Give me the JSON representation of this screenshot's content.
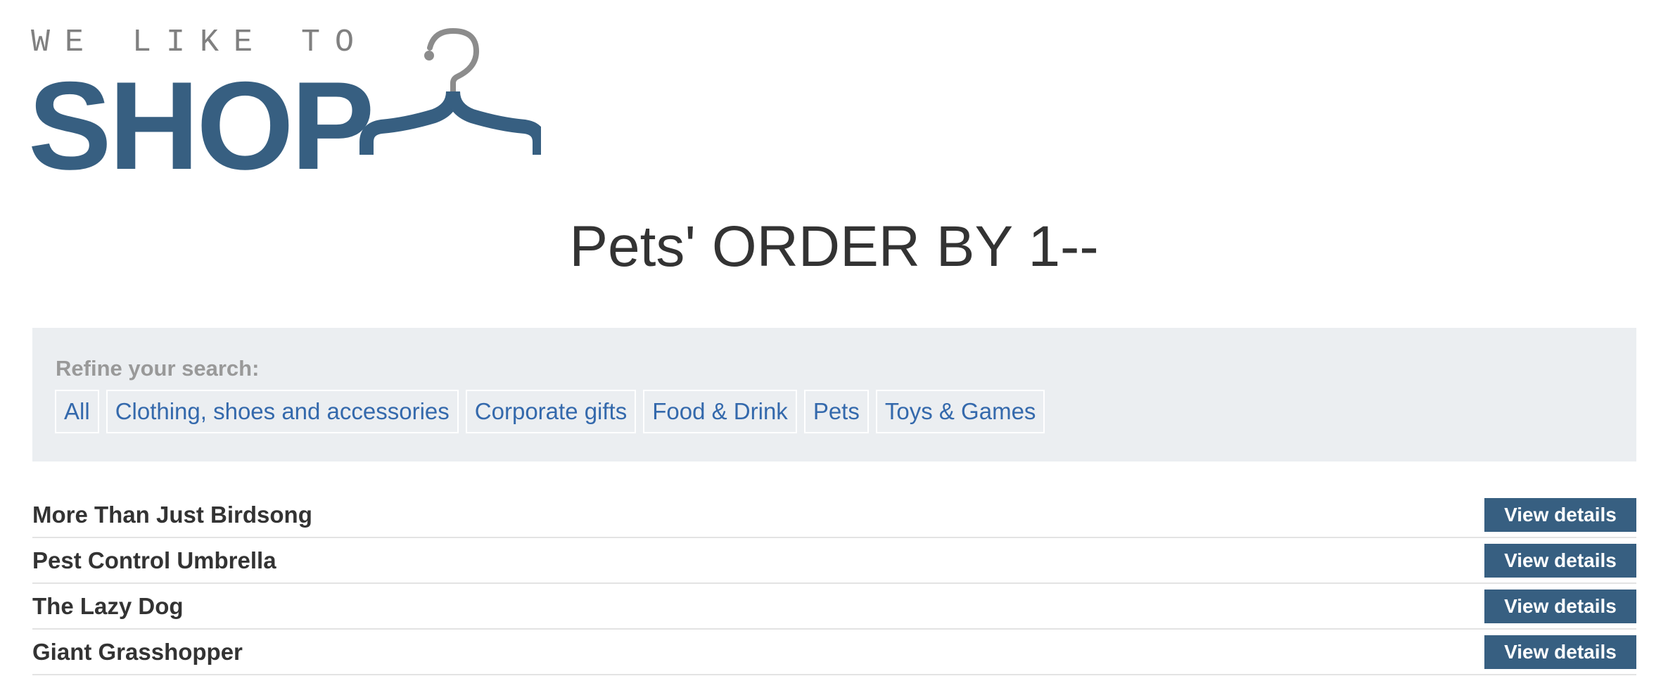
{
  "logo": {
    "tagline": "WE LIKE TO",
    "word": "SHOP"
  },
  "page": {
    "title": "Pets' ORDER BY 1--"
  },
  "filters": {
    "label": "Refine your search:",
    "categories": [
      "All",
      "Clothing, shoes and accessories",
      "Corporate gifts",
      "Food & Drink",
      "Pets",
      "Toys & Games"
    ]
  },
  "products": [
    {
      "name": "More Than Just Birdsong",
      "button": "View details"
    },
    {
      "name": "Pest Control Umbrella",
      "button": "View details"
    },
    {
      "name": "The Lazy Dog",
      "button": "View details"
    },
    {
      "name": "Giant Grasshopper",
      "button": "View details"
    }
  ],
  "colors": {
    "brand": "#375f81",
    "link": "#3469ac",
    "panel": "#ebeef1",
    "muted": "#999999",
    "text": "#333333"
  },
  "icons": {
    "logo_graphic": "hanger-icon"
  }
}
